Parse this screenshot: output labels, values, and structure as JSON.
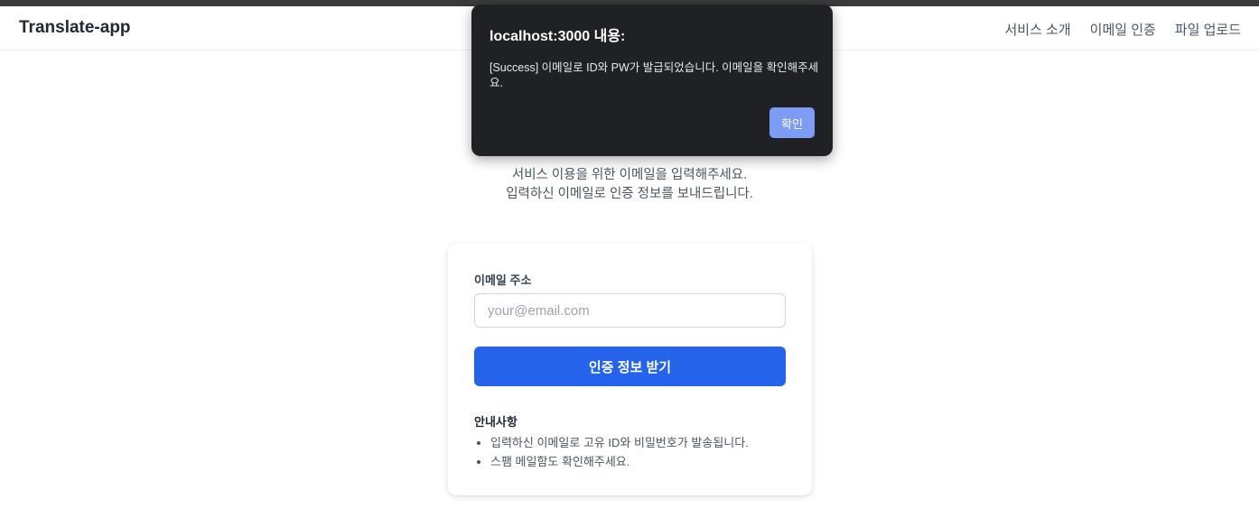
{
  "navbar": {
    "brand": "Translate-app",
    "links": [
      "서비스 소개",
      "이메일 인증",
      "파일 업로드"
    ]
  },
  "intro": {
    "line1": "서비스 이용을 위한 이메일을 입력해주세요.",
    "line2": "입력하신 이메일로 인증 정보를 보내드립니다."
  },
  "form": {
    "email_label": "이메일 주소",
    "email_value": "",
    "email_placeholder": "your@email.com",
    "submit_label": "인증 정보 받기"
  },
  "notice": {
    "title": "안내사항",
    "items": [
      "입력하신 이메일로 고유 ID와 비밀번호가 발송됩니다.",
      "스팸 메일함도 확인해주세요."
    ]
  },
  "dialog": {
    "title": "localhost:3000 내용:",
    "message": "[Success] 이메일로 ID와 PW가 발급되었습니다. 이메일을 확인해주세요.",
    "ok_label": "확인"
  },
  "colors": {
    "primary": "#2563eb",
    "dialog_bg": "#202124",
    "dialog_button": "#7c9cf5"
  }
}
